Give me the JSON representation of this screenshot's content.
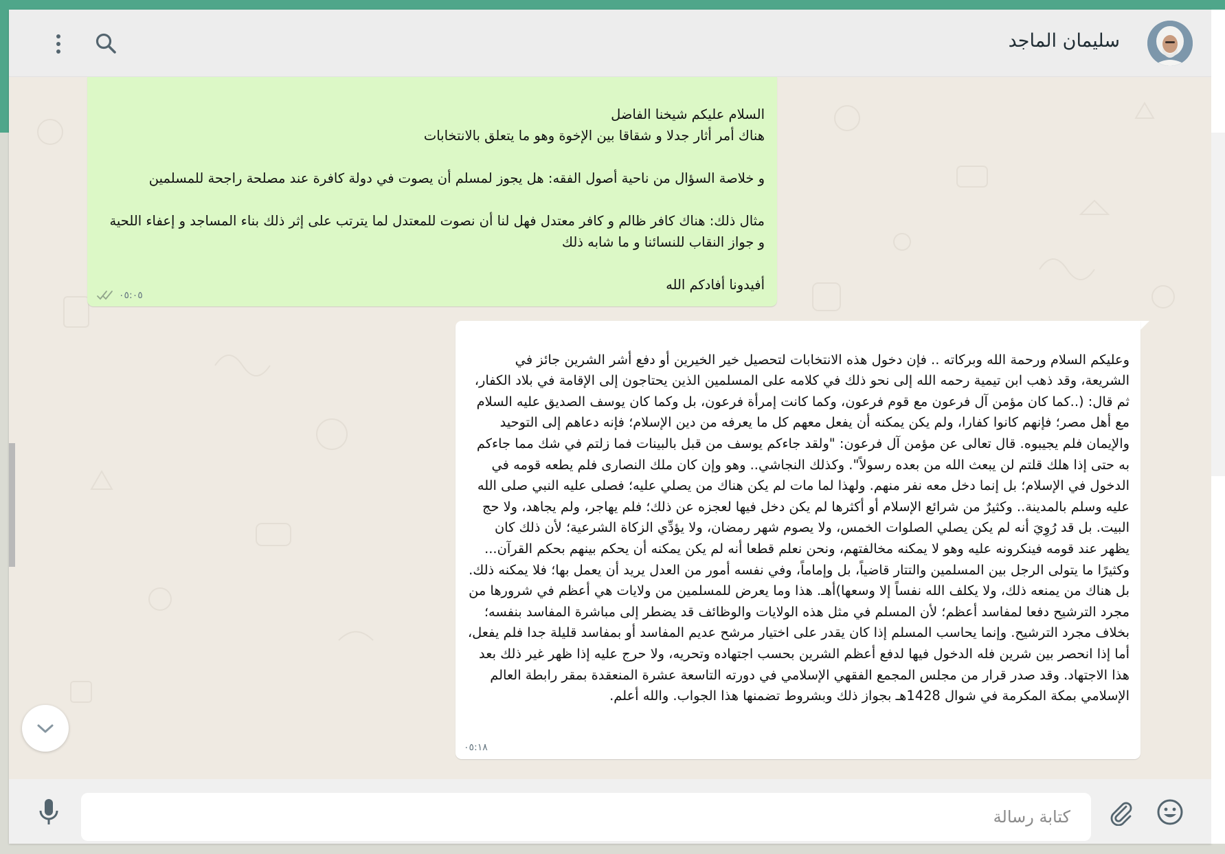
{
  "contact": {
    "name": "سليمان الماجد",
    "avatar_icon": "sheikh-avatar"
  },
  "header": {
    "search_icon": "search-icon",
    "menu_icon": "more-vertical-icon"
  },
  "messages": [
    {
      "direction": "outgoing",
      "text": "السلام عليكم شيخنا الفاضل\nهناك أمر أثار جدلا و شقاقا بين الإخوة وهو ما يتعلق بالانتخابات\n\nو خلاصة السؤال من ناحية أصول الفقه: هل يجوز لمسلم أن يصوت في دولة كافرة عند مصلحة راجحة للمسلمين\n\nمثال ذلك: هناك كافر ظالم و كافر معتدل فهل لنا أن نصوت للمعتدل لما يترتب على إثر ذلك بناء المساجد و إعفاء اللحية و جواز النقاب للنسائنا و ما شابه ذلك\n\nأفيدونا أفادكم الله",
      "time": "٠٥:٠٥",
      "status": "read"
    },
    {
      "direction": "incoming",
      "text": "وعليكم السلام ورحمة الله وبركاته .. فإن دخول هذه الانتخابات لتحصيل خير الخيرين أو دفع أشر الشرين جائز في الشريعة، وقد ذهب ابن تيمية رحمه الله إلى نحو ذلك في كلامه على المسلمين الذين يحتاجون إلى الإقامة في بلاد الكفار، ثم قال: (..كما كان مؤمن آل فرعون مع قوم فرعون، وكما كانت إمرأة فرعون، بل وكما كان يوسف الصديق عليه السلام مع أهل مصر؛ فإنهم كانوا كفارا، ولم يكن يمكنه أن يفعل معهم كل ما يعرفه من دين الإسلام؛ فإنه دعاهم إلى التوحيد والإيمان فلم يجيبوه. قال تعالى عن مؤمن آل فرعون: \"ولقد جاءكم يوسف من قبل بالبينات فما زلتم في شك مما جاءكم به حتى إذا هلك قلتم لن يبعث الله من بعده رسولاً\". وكذلك النجاشي.. وهو وإن كان ملك النصارى فلم يطعه قومه في الدخول في الإسلام؛ بل إنما دخل معه نفر منهم. ولهذا لما مات لم يكن هناك من يصلي عليه؛ فصلى عليه النبي صلى الله عليه وسلم بالمدينة.. وكثيرٌ من شرائع الإسلام أو أكثرها لم يكن دخل فيها لعجزه عن ذلك؛ فلم يهاجر، ولم يجاهد، ولا حج البيت. بل قد رُوِيَ أنه لم يكن يصلي الصلوات الخمس، ولا يصوم شهر رمضان، ولا يؤدِّي الزكاة الشرعية؛ لأن ذلك كان يظهر عند قومه فينكرونه عليه وهو لا يمكنه مخالفتهم، ونحن نعلم قطعا أنه لم يكن يمكنه أن يحكم بينهم بحكم القرآن... وكثيرًا ما يتولى الرجل بين المسلمين والتتار قاضياً، بل وإماماً، وفي نفسه أمور من العدل يريد أن يعمل بها؛ فلا يمكنه ذلك. بل هناك من يمنعه ذلك، ولا يكلف الله نفساً إلا وسعها)أهـ. هذا وما يعرض للمسلمين من ولايات هي أعظم في شرورها من مجرد الترشيح دفعا لمفاسد أعظم؛ لأن المسلم في مثل هذه الولايات والوظائف قد يضطر إلى مباشرة المفاسد بنفسه؛ بخلاف مجرد الترشيح. وإنما يحاسب المسلم إذا كان يقدر على اختيار مرشح عديم المفاسد أو بمفاسد قليلة جدا فلم يفعل، أما إذا انحصر بين شرين فله الدخول فيها لدفع أعظم الشرين بحسب اجتهاده وتحريه، ولا حرج عليه إذا ظهر غير ذلك بعد هذا الاجتهاد. وقد صدر قرار من مجلس المجمع الفقهي الإسلامي في دورته التاسعة عشرة المنعقدة بمقر رابطة العالم الإسلامي بمكة المكرمة في شوال 1428هـ بجواز ذلك وبشروط تضمنها هذا الجواب. والله أعلم.",
      "time": "٠٥:١٨"
    }
  ],
  "composer": {
    "placeholder": "كتابة رسالة",
    "emoji_icon": "emoji-icon",
    "attach_icon": "paperclip-icon",
    "mic_icon": "microphone-icon"
  },
  "scroll_down_icon": "chevron-down-icon",
  "colors": {
    "accent": "#4fa68a",
    "outgoing_bubble": "#dcf8c6",
    "incoming_bubble": "#ffffff",
    "chat_background": "#efeae2",
    "read_ticks": "#92a58c"
  }
}
